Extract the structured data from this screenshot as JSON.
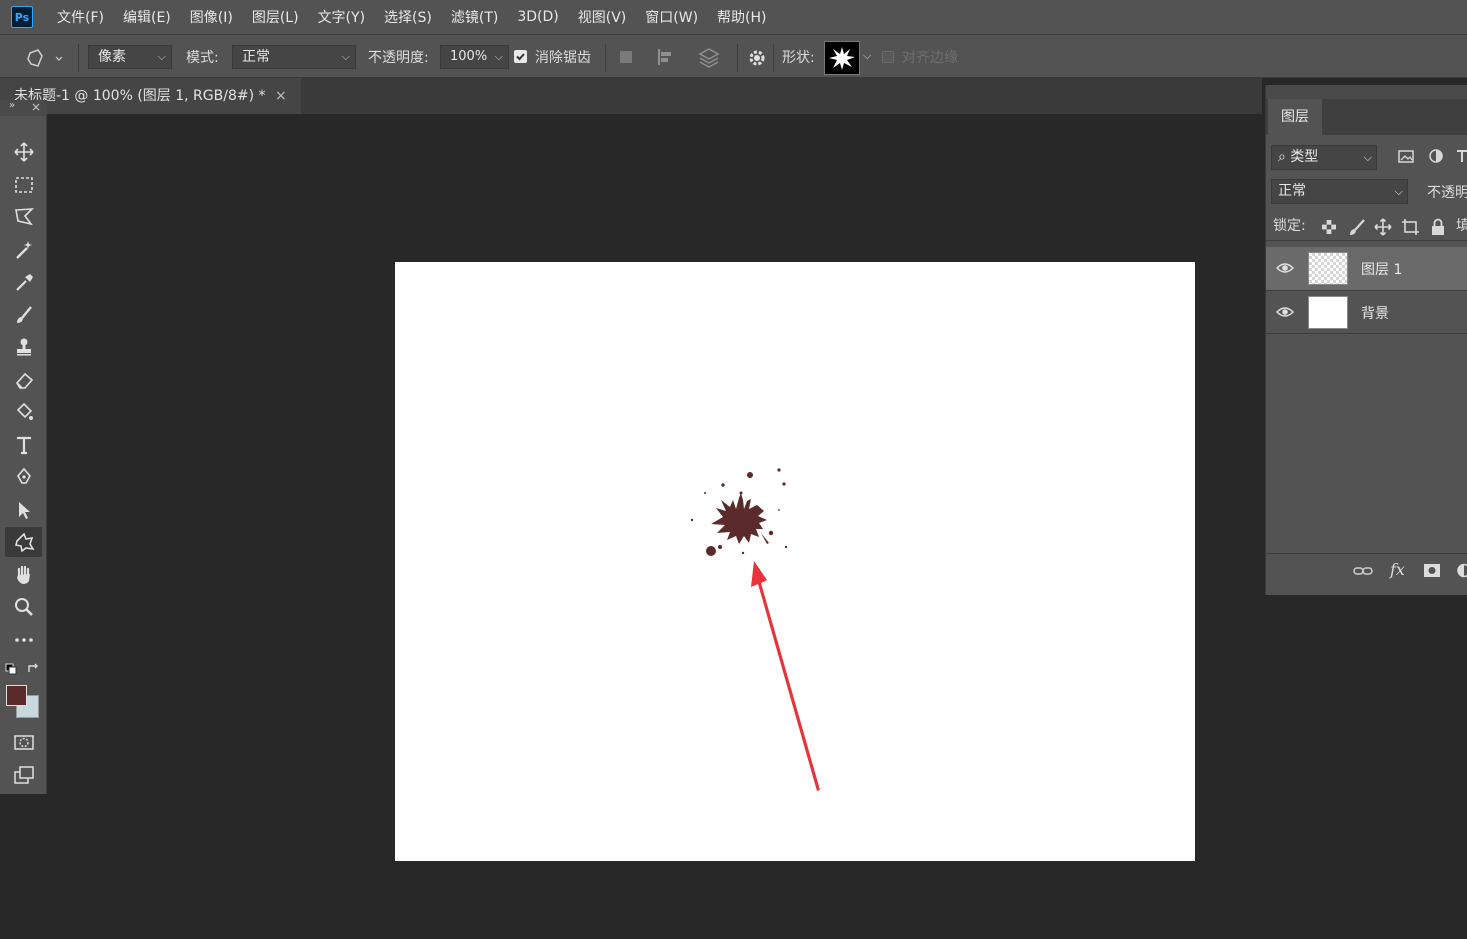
{
  "app": {
    "logo_text": "Ps",
    "menu": [
      "文件(F)",
      "编辑(E)",
      "图像(I)",
      "图层(L)",
      "文字(Y)",
      "选择(S)",
      "滤镜(T)",
      "3D(D)",
      "视图(V)",
      "窗口(W)",
      "帮助(H)"
    ]
  },
  "options": {
    "fill_type": "像素",
    "mode_label": "模式:",
    "mode_value": "正常",
    "opacity_label": "不透明度:",
    "opacity_value": "100%",
    "antialias_label": "消除锯齿",
    "antialias_checked": true,
    "shape_label": "形状:",
    "align_edges_label": "对齐边缘"
  },
  "document": {
    "tab_title": "未标题-1 @ 100% (图层 1, RGB/8#) *",
    "close_glyph": "×",
    "splatter_color": "#5b2a2a",
    "arrow_color": "#e8333a"
  },
  "colors": {
    "foreground": "#5b2a2a",
    "background": "#c8d8dc"
  },
  "layers_panel": {
    "tab_label": "图层",
    "filter_label": "类型",
    "blend_mode": "正常",
    "opacity_label": "不透明",
    "lock_label": "锁定:",
    "fill_label": "填",
    "layers": [
      {
        "name": "图层 1",
        "selected": true,
        "thumb": "transparent"
      },
      {
        "name": "背景",
        "selected": false,
        "thumb": "white"
      }
    ]
  }
}
